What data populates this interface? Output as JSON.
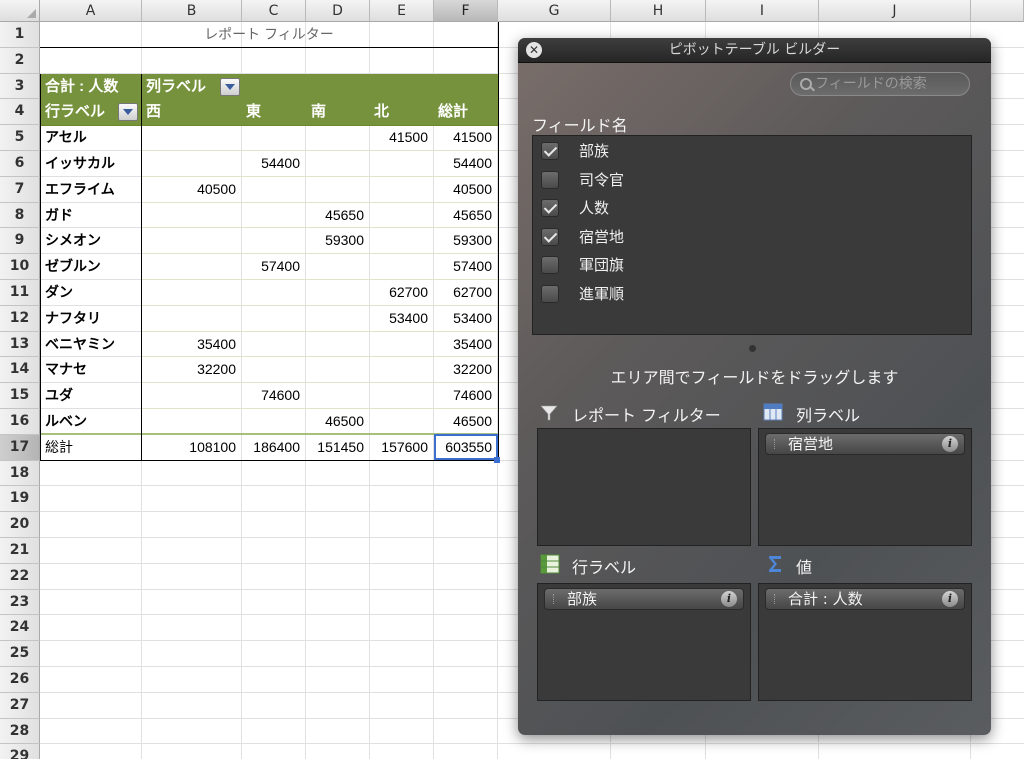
{
  "spreadsheet": {
    "columns": [
      "A",
      "B",
      "C",
      "D",
      "E",
      "F",
      "G",
      "H",
      "I",
      "J"
    ],
    "selected_column": "F",
    "rows": [
      "1",
      "2",
      "3",
      "4",
      "5",
      "6",
      "7",
      "8",
      "9",
      "10",
      "11",
      "12",
      "13",
      "14",
      "15",
      "16",
      "17",
      "18",
      "19",
      "20",
      "21",
      "22",
      "23",
      "24",
      "25",
      "26",
      "27",
      "28",
      "29"
    ],
    "selected_row": "17",
    "report_filter_label": "レポート フィルター",
    "pivot": {
      "value_header": "合計 : 人数",
      "column_label_header": "列ラベル",
      "row_label_header": "行ラベル",
      "column_headers": [
        "西",
        "東",
        "南",
        "北",
        "総計"
      ],
      "rows": [
        {
          "label": "アセル",
          "west": "",
          "east": "",
          "south": "",
          "north": "41500",
          "total": "41500"
        },
        {
          "label": "イッサカル",
          "west": "",
          "east": "54400",
          "south": "",
          "north": "",
          "total": "54400"
        },
        {
          "label": "エフライム",
          "west": "40500",
          "east": "",
          "south": "",
          "north": "",
          "total": "40500"
        },
        {
          "label": "ガド",
          "west": "",
          "east": "",
          "south": "45650",
          "north": "",
          "total": "45650"
        },
        {
          "label": "シメオン",
          "west": "",
          "east": "",
          "south": "59300",
          "north": "",
          "total": "59300"
        },
        {
          "label": "ゼブルン",
          "west": "",
          "east": "57400",
          "south": "",
          "north": "",
          "total": "57400"
        },
        {
          "label": "ダン",
          "west": "",
          "east": "",
          "south": "",
          "north": "62700",
          "total": "62700"
        },
        {
          "label": "ナフタリ",
          "west": "",
          "east": "",
          "south": "",
          "north": "53400",
          "total": "53400"
        },
        {
          "label": "ベニヤミン",
          "west": "35400",
          "east": "",
          "south": "",
          "north": "",
          "total": "35400"
        },
        {
          "label": "マナセ",
          "west": "32200",
          "east": "",
          "south": "",
          "north": "",
          "total": "32200"
        },
        {
          "label": "ユダ",
          "west": "",
          "east": "74600",
          "south": "",
          "north": "",
          "total": "74600"
        },
        {
          "label": "ルベン",
          "west": "",
          "east": "",
          "south": "46500",
          "north": "",
          "total": "46500"
        }
      ],
      "grand_total": {
        "label": "総計",
        "west": "108100",
        "east": "186400",
        "south": "151450",
        "north": "157600",
        "total": "603550"
      }
    }
  },
  "builder": {
    "title": "ピボットテーブル ビルダー",
    "search_placeholder": "フィールドの検索",
    "field_names_label": "フィールド名",
    "fields": [
      {
        "name": "部族",
        "checked": true
      },
      {
        "name": "司令官",
        "checked": false
      },
      {
        "name": "人数",
        "checked": true
      },
      {
        "name": "宿営地",
        "checked": true
      },
      {
        "name": "軍団旗",
        "checked": false
      },
      {
        "name": "進軍順",
        "checked": false
      }
    ],
    "drag_hint": "エリア間でフィールドをドラッグします",
    "areas": {
      "report_filter": {
        "label": "レポート フィルター",
        "items": []
      },
      "column_labels": {
        "label": "列ラベル",
        "items": [
          "宿営地"
        ]
      },
      "row_labels": {
        "label": "行ラベル",
        "items": [
          "部族"
        ]
      },
      "values": {
        "label": "値",
        "items": [
          "合計 : 人数"
        ]
      }
    },
    "info_glyph": "i",
    "close_glyph": "✕"
  }
}
